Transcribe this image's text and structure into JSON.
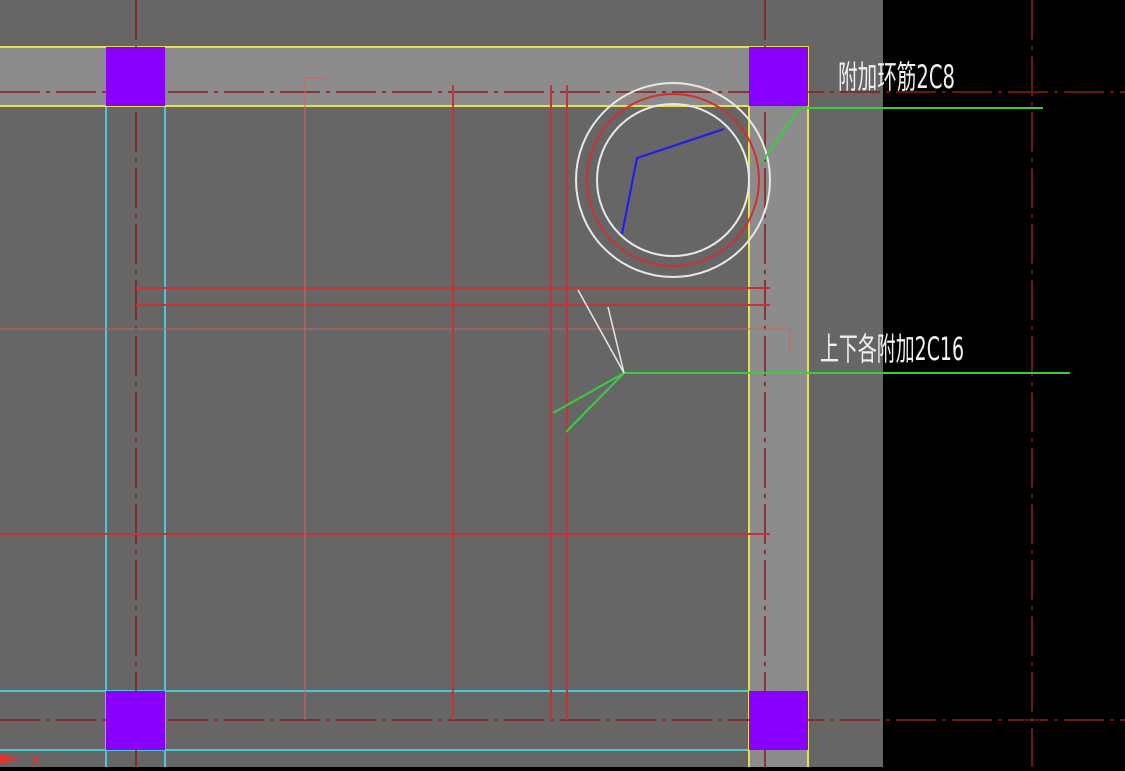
{
  "drawing": {
    "annotations": {
      "ring_rebar": "附加环筋2C8",
      "opening_rebar": "上下各附加2C16"
    },
    "axis_marker": "X",
    "colors": {
      "model_space": "#000000",
      "slab_area": "#666666",
      "beam_fill": "#8c8c8c",
      "beam_outline": "#e6e04a",
      "column_fill": "#8a00ff",
      "rebar_line": "#c83232",
      "grid_axis": "#8a1a1a",
      "cyan_line": "#4dc8d0",
      "leader_line": "#3ccc3c",
      "opening_circle": "#e8e8e8",
      "opening_inner": "#d03030",
      "blue_line": "#1a1aff",
      "text": "#f0f0f0"
    }
  }
}
